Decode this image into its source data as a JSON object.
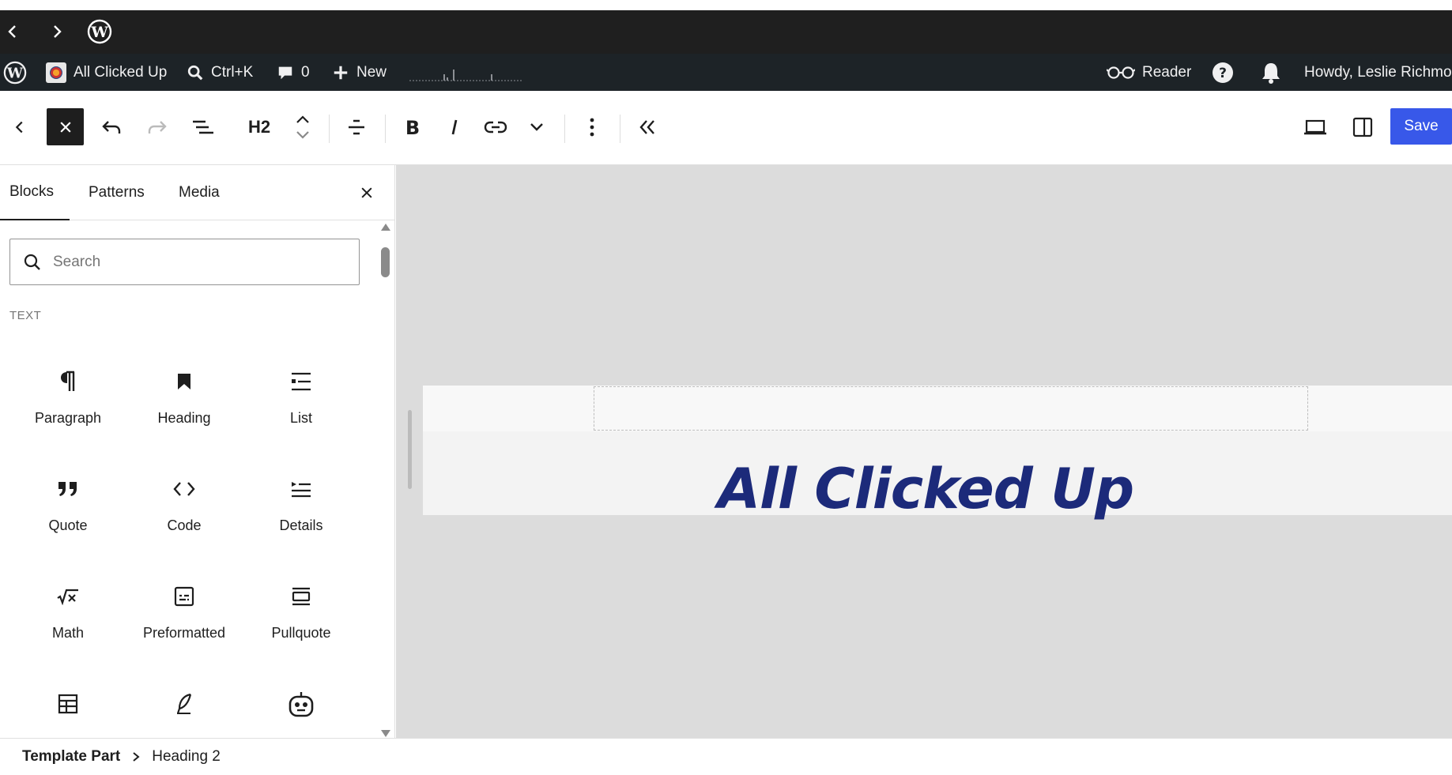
{
  "browser": {
    "back_icon": "chevron-left-icon",
    "forward_icon": "chevron-right-icon",
    "logo_icon": "wordpress-logo-icon"
  },
  "admin_bar": {
    "site_name": "All Clicked Up",
    "search_shortcut": "Ctrl+K",
    "comments_count": "0",
    "new_label": "New",
    "reader_label": "Reader",
    "greeting": "Howdy, Leslie Richmor"
  },
  "toolbar": {
    "heading_level": "H2",
    "save_label": "Save"
  },
  "inserter": {
    "tabs": [
      "Blocks",
      "Patterns",
      "Media"
    ],
    "active_tab": "Blocks",
    "search_placeholder": "Search",
    "category": "TEXT",
    "blocks": [
      {
        "label": "Paragraph",
        "icon": "paragraph-icon"
      },
      {
        "label": "Heading",
        "icon": "heading-bookmark-icon"
      },
      {
        "label": "List",
        "icon": "list-icon"
      },
      {
        "label": "Quote",
        "icon": "quote-icon"
      },
      {
        "label": "Code",
        "icon": "code-icon"
      },
      {
        "label": "Details",
        "icon": "details-icon"
      },
      {
        "label": "Math",
        "icon": "math-icon"
      },
      {
        "label": "Preformatted",
        "icon": "preformatted-icon"
      },
      {
        "label": "Pullquote",
        "icon": "pullquote-icon"
      },
      {
        "label": "",
        "icon": "table-icon"
      },
      {
        "label": "",
        "icon": "verse-feather-icon"
      },
      {
        "label": "",
        "icon": "robot-icon"
      }
    ]
  },
  "canvas": {
    "site_title": "All Clicked Up",
    "title_color": "#1c2a7a"
  },
  "breadcrumb": {
    "root": "Template Part",
    "current": "Heading 2"
  },
  "colors": {
    "admin_bar_bg": "#1d2327",
    "save_button_bg": "#3858e9",
    "canvas_bg": "#dcdcdc"
  }
}
